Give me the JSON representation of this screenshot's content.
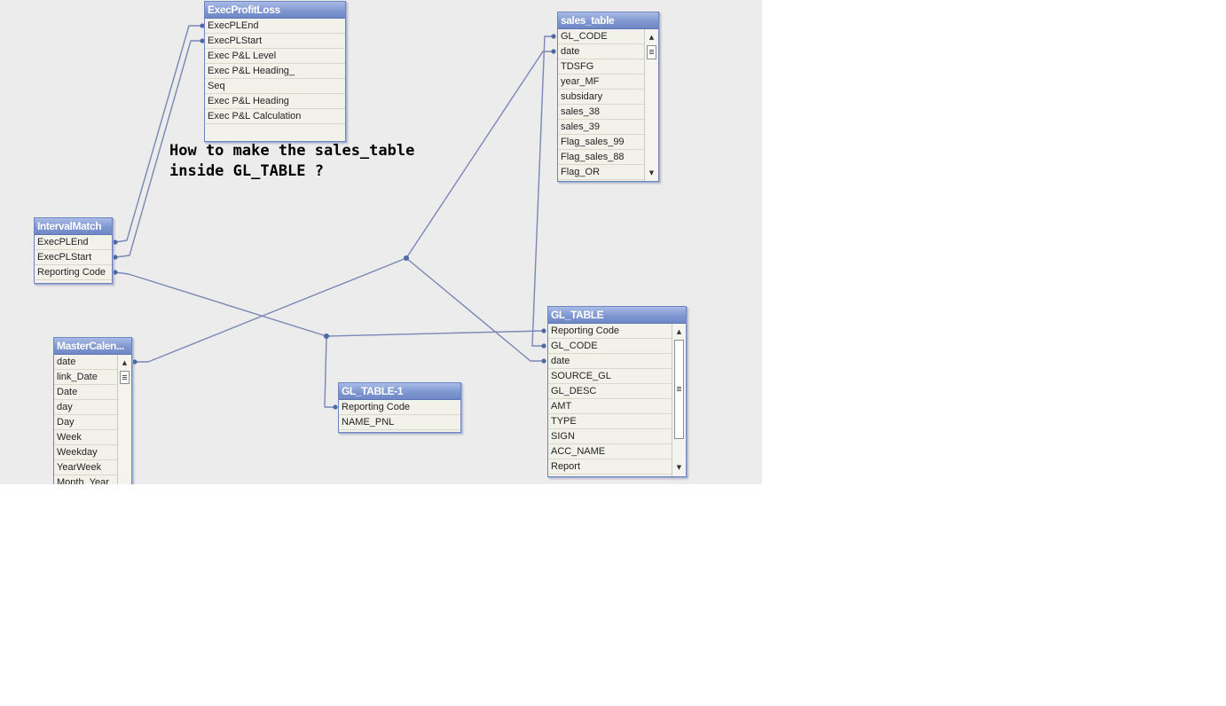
{
  "question": {
    "line1": "How to make the sales_table",
    "line2": "inside GL_TABLE ?"
  },
  "colors": {
    "canvas": "#ececec",
    "link": "#7a86b5",
    "title_bar": "#7d95cf"
  },
  "tables": {
    "exec_profit_loss": {
      "title": "ExecProfitLoss",
      "fields": [
        "ExecPLEnd",
        "ExecPLStart",
        "Exec P&L Level",
        "Exec P&L Heading_",
        "Seq",
        "Exec P&L Heading",
        "Exec P&L Calculation"
      ]
    },
    "sales_table": {
      "title": "sales_table",
      "fields": [
        "GL_CODE",
        "date",
        "TDSFG",
        "year_MF",
        "subsidary",
        "sales_38",
        "sales_39",
        "Flag_sales_99",
        "Flag_sales_88",
        "Flag_OR"
      ]
    },
    "interval_match": {
      "title": "IntervalMatch",
      "fields": [
        "ExecPLEnd",
        "ExecPLStart",
        "Reporting Code"
      ]
    },
    "master_calendar": {
      "title": "MasterCalen...",
      "fields": [
        "date",
        "link_Date",
        "Date",
        "day",
        "Day",
        "Week",
        "Weekday",
        "YearWeek",
        "Month_Year"
      ]
    },
    "gl_table": {
      "title": "GL_TABLE",
      "fields": [
        "Reporting Code",
        "GL_CODE",
        "date",
        "SOURCE_GL",
        "GL_DESC",
        "AMT",
        "TYPE",
        "SIGN",
        "ACC_NAME",
        "Report"
      ]
    },
    "gl_table_1": {
      "title": "GL_TABLE-1",
      "fields": [
        "Reporting Code",
        "NAME_PNL"
      ]
    }
  }
}
